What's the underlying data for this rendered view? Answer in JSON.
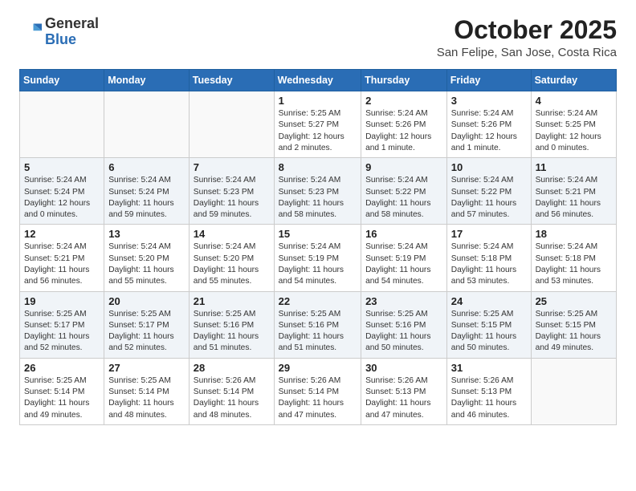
{
  "header": {
    "logo_general": "General",
    "logo_blue": "Blue",
    "month_title": "October 2025",
    "location": "San Felipe, San Jose, Costa Rica"
  },
  "days_of_week": [
    "Sunday",
    "Monday",
    "Tuesday",
    "Wednesday",
    "Thursday",
    "Friday",
    "Saturday"
  ],
  "weeks": [
    [
      {
        "day": "",
        "info": ""
      },
      {
        "day": "",
        "info": ""
      },
      {
        "day": "",
        "info": ""
      },
      {
        "day": "1",
        "info": "Sunrise: 5:25 AM\nSunset: 5:27 PM\nDaylight: 12 hours\nand 2 minutes."
      },
      {
        "day": "2",
        "info": "Sunrise: 5:24 AM\nSunset: 5:26 PM\nDaylight: 12 hours\nand 1 minute."
      },
      {
        "day": "3",
        "info": "Sunrise: 5:24 AM\nSunset: 5:26 PM\nDaylight: 12 hours\nand 1 minute."
      },
      {
        "day": "4",
        "info": "Sunrise: 5:24 AM\nSunset: 5:25 PM\nDaylight: 12 hours\nand 0 minutes."
      }
    ],
    [
      {
        "day": "5",
        "info": "Sunrise: 5:24 AM\nSunset: 5:24 PM\nDaylight: 12 hours\nand 0 minutes."
      },
      {
        "day": "6",
        "info": "Sunrise: 5:24 AM\nSunset: 5:24 PM\nDaylight: 11 hours\nand 59 minutes."
      },
      {
        "day": "7",
        "info": "Sunrise: 5:24 AM\nSunset: 5:23 PM\nDaylight: 11 hours\nand 59 minutes."
      },
      {
        "day": "8",
        "info": "Sunrise: 5:24 AM\nSunset: 5:23 PM\nDaylight: 11 hours\nand 58 minutes."
      },
      {
        "day": "9",
        "info": "Sunrise: 5:24 AM\nSunset: 5:22 PM\nDaylight: 11 hours\nand 58 minutes."
      },
      {
        "day": "10",
        "info": "Sunrise: 5:24 AM\nSunset: 5:22 PM\nDaylight: 11 hours\nand 57 minutes."
      },
      {
        "day": "11",
        "info": "Sunrise: 5:24 AM\nSunset: 5:21 PM\nDaylight: 11 hours\nand 56 minutes."
      }
    ],
    [
      {
        "day": "12",
        "info": "Sunrise: 5:24 AM\nSunset: 5:21 PM\nDaylight: 11 hours\nand 56 minutes."
      },
      {
        "day": "13",
        "info": "Sunrise: 5:24 AM\nSunset: 5:20 PM\nDaylight: 11 hours\nand 55 minutes."
      },
      {
        "day": "14",
        "info": "Sunrise: 5:24 AM\nSunset: 5:20 PM\nDaylight: 11 hours\nand 55 minutes."
      },
      {
        "day": "15",
        "info": "Sunrise: 5:24 AM\nSunset: 5:19 PM\nDaylight: 11 hours\nand 54 minutes."
      },
      {
        "day": "16",
        "info": "Sunrise: 5:24 AM\nSunset: 5:19 PM\nDaylight: 11 hours\nand 54 minutes."
      },
      {
        "day": "17",
        "info": "Sunrise: 5:24 AM\nSunset: 5:18 PM\nDaylight: 11 hours\nand 53 minutes."
      },
      {
        "day": "18",
        "info": "Sunrise: 5:24 AM\nSunset: 5:18 PM\nDaylight: 11 hours\nand 53 minutes."
      }
    ],
    [
      {
        "day": "19",
        "info": "Sunrise: 5:25 AM\nSunset: 5:17 PM\nDaylight: 11 hours\nand 52 minutes."
      },
      {
        "day": "20",
        "info": "Sunrise: 5:25 AM\nSunset: 5:17 PM\nDaylight: 11 hours\nand 52 minutes."
      },
      {
        "day": "21",
        "info": "Sunrise: 5:25 AM\nSunset: 5:16 PM\nDaylight: 11 hours\nand 51 minutes."
      },
      {
        "day": "22",
        "info": "Sunrise: 5:25 AM\nSunset: 5:16 PM\nDaylight: 11 hours\nand 51 minutes."
      },
      {
        "day": "23",
        "info": "Sunrise: 5:25 AM\nSunset: 5:16 PM\nDaylight: 11 hours\nand 50 minutes."
      },
      {
        "day": "24",
        "info": "Sunrise: 5:25 AM\nSunset: 5:15 PM\nDaylight: 11 hours\nand 50 minutes."
      },
      {
        "day": "25",
        "info": "Sunrise: 5:25 AM\nSunset: 5:15 PM\nDaylight: 11 hours\nand 49 minutes."
      }
    ],
    [
      {
        "day": "26",
        "info": "Sunrise: 5:25 AM\nSunset: 5:14 PM\nDaylight: 11 hours\nand 49 minutes."
      },
      {
        "day": "27",
        "info": "Sunrise: 5:25 AM\nSunset: 5:14 PM\nDaylight: 11 hours\nand 48 minutes."
      },
      {
        "day": "28",
        "info": "Sunrise: 5:26 AM\nSunset: 5:14 PM\nDaylight: 11 hours\nand 48 minutes."
      },
      {
        "day": "29",
        "info": "Sunrise: 5:26 AM\nSunset: 5:14 PM\nDaylight: 11 hours\nand 47 minutes."
      },
      {
        "day": "30",
        "info": "Sunrise: 5:26 AM\nSunset: 5:13 PM\nDaylight: 11 hours\nand 47 minutes."
      },
      {
        "day": "31",
        "info": "Sunrise: 5:26 AM\nSunset: 5:13 PM\nDaylight: 11 hours\nand 46 minutes."
      },
      {
        "day": "",
        "info": ""
      }
    ]
  ]
}
